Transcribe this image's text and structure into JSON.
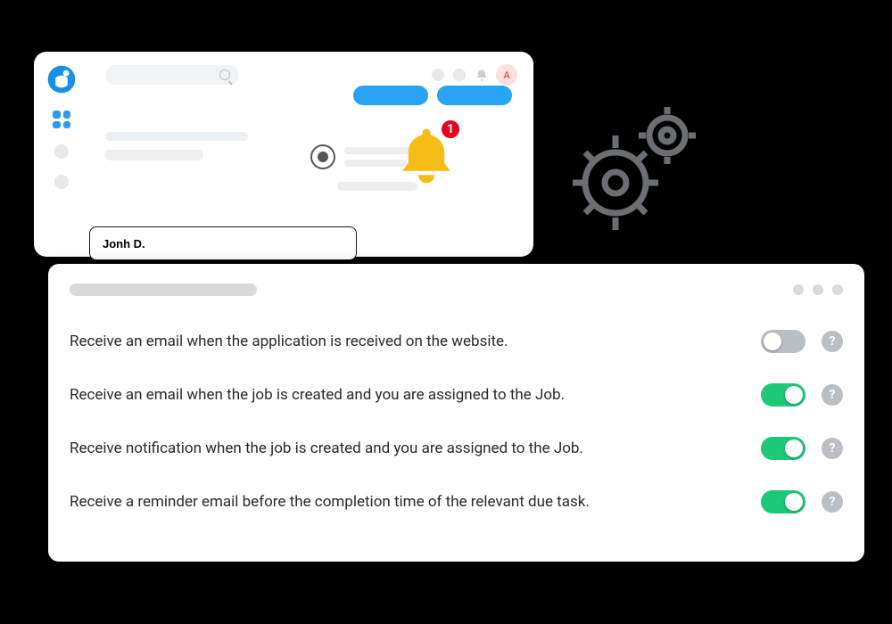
{
  "app": {
    "avatar_letter": "A",
    "name_input_value": "Jonh D."
  },
  "bell": {
    "badge_count": "1"
  },
  "settings": {
    "rows": [
      {
        "label": "Receive an email when the application is received on the website.",
        "enabled": false
      },
      {
        "label": "Receive an email when the job is created and you are assigned to the Job.",
        "enabled": true
      },
      {
        "label": "Receive notification when the job is created and you are assigned to the Job.",
        "enabled": true
      },
      {
        "label": "Receive a reminder email before the completion time of the relevant due task.",
        "enabled": true
      }
    ],
    "help_glyph": "?"
  }
}
